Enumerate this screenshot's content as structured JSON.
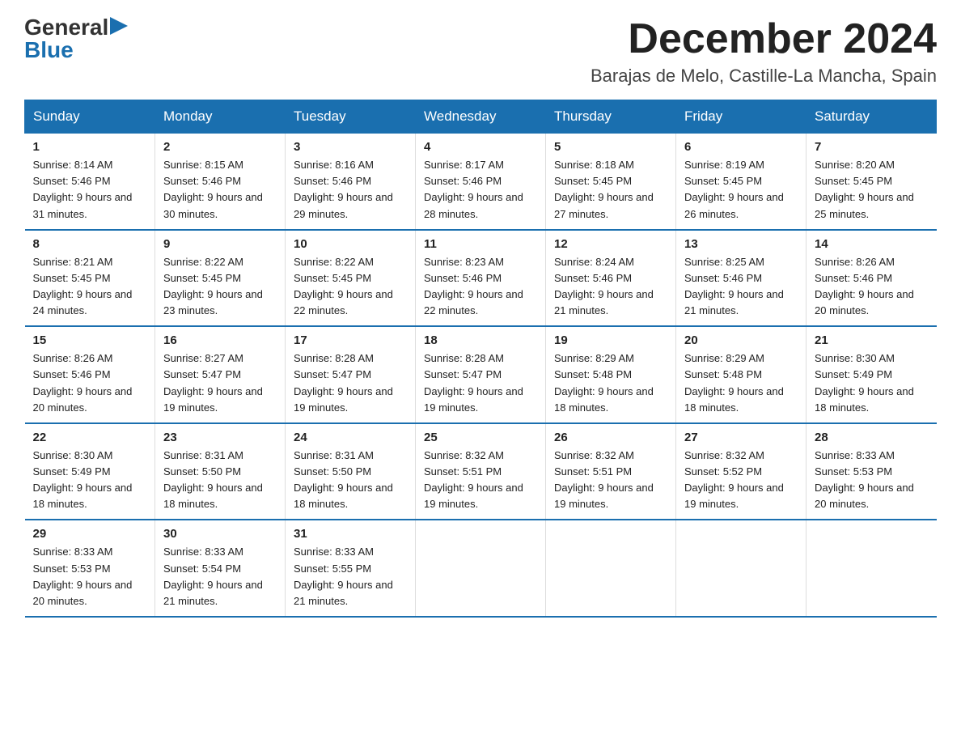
{
  "header": {
    "logo_general": "General",
    "logo_blue": "Blue",
    "month": "December 2024",
    "location": "Barajas de Melo, Castille-La Mancha, Spain"
  },
  "days_of_week": [
    "Sunday",
    "Monday",
    "Tuesday",
    "Wednesday",
    "Thursday",
    "Friday",
    "Saturday"
  ],
  "weeks": [
    [
      {
        "num": "1",
        "sunrise": "8:14 AM",
        "sunset": "5:46 PM",
        "daylight": "9 hours and 31 minutes."
      },
      {
        "num": "2",
        "sunrise": "8:15 AM",
        "sunset": "5:46 PM",
        "daylight": "9 hours and 30 minutes."
      },
      {
        "num": "3",
        "sunrise": "8:16 AM",
        "sunset": "5:46 PM",
        "daylight": "9 hours and 29 minutes."
      },
      {
        "num": "4",
        "sunrise": "8:17 AM",
        "sunset": "5:46 PM",
        "daylight": "9 hours and 28 minutes."
      },
      {
        "num": "5",
        "sunrise": "8:18 AM",
        "sunset": "5:45 PM",
        "daylight": "9 hours and 27 minutes."
      },
      {
        "num": "6",
        "sunrise": "8:19 AM",
        "sunset": "5:45 PM",
        "daylight": "9 hours and 26 minutes."
      },
      {
        "num": "7",
        "sunrise": "8:20 AM",
        "sunset": "5:45 PM",
        "daylight": "9 hours and 25 minutes."
      }
    ],
    [
      {
        "num": "8",
        "sunrise": "8:21 AM",
        "sunset": "5:45 PM",
        "daylight": "9 hours and 24 minutes."
      },
      {
        "num": "9",
        "sunrise": "8:22 AM",
        "sunset": "5:45 PM",
        "daylight": "9 hours and 23 minutes."
      },
      {
        "num": "10",
        "sunrise": "8:22 AM",
        "sunset": "5:45 PM",
        "daylight": "9 hours and 22 minutes."
      },
      {
        "num": "11",
        "sunrise": "8:23 AM",
        "sunset": "5:46 PM",
        "daylight": "9 hours and 22 minutes."
      },
      {
        "num": "12",
        "sunrise": "8:24 AM",
        "sunset": "5:46 PM",
        "daylight": "9 hours and 21 minutes."
      },
      {
        "num": "13",
        "sunrise": "8:25 AM",
        "sunset": "5:46 PM",
        "daylight": "9 hours and 21 minutes."
      },
      {
        "num": "14",
        "sunrise": "8:26 AM",
        "sunset": "5:46 PM",
        "daylight": "9 hours and 20 minutes."
      }
    ],
    [
      {
        "num": "15",
        "sunrise": "8:26 AM",
        "sunset": "5:46 PM",
        "daylight": "9 hours and 20 minutes."
      },
      {
        "num": "16",
        "sunrise": "8:27 AM",
        "sunset": "5:47 PM",
        "daylight": "9 hours and 19 minutes."
      },
      {
        "num": "17",
        "sunrise": "8:28 AM",
        "sunset": "5:47 PM",
        "daylight": "9 hours and 19 minutes."
      },
      {
        "num": "18",
        "sunrise": "8:28 AM",
        "sunset": "5:47 PM",
        "daylight": "9 hours and 19 minutes."
      },
      {
        "num": "19",
        "sunrise": "8:29 AM",
        "sunset": "5:48 PM",
        "daylight": "9 hours and 18 minutes."
      },
      {
        "num": "20",
        "sunrise": "8:29 AM",
        "sunset": "5:48 PM",
        "daylight": "9 hours and 18 minutes."
      },
      {
        "num": "21",
        "sunrise": "8:30 AM",
        "sunset": "5:49 PM",
        "daylight": "9 hours and 18 minutes."
      }
    ],
    [
      {
        "num": "22",
        "sunrise": "8:30 AM",
        "sunset": "5:49 PM",
        "daylight": "9 hours and 18 minutes."
      },
      {
        "num": "23",
        "sunrise": "8:31 AM",
        "sunset": "5:50 PM",
        "daylight": "9 hours and 18 minutes."
      },
      {
        "num": "24",
        "sunrise": "8:31 AM",
        "sunset": "5:50 PM",
        "daylight": "9 hours and 18 minutes."
      },
      {
        "num": "25",
        "sunrise": "8:32 AM",
        "sunset": "5:51 PM",
        "daylight": "9 hours and 19 minutes."
      },
      {
        "num": "26",
        "sunrise": "8:32 AM",
        "sunset": "5:51 PM",
        "daylight": "9 hours and 19 minutes."
      },
      {
        "num": "27",
        "sunrise": "8:32 AM",
        "sunset": "5:52 PM",
        "daylight": "9 hours and 19 minutes."
      },
      {
        "num": "28",
        "sunrise": "8:33 AM",
        "sunset": "5:53 PM",
        "daylight": "9 hours and 20 minutes."
      }
    ],
    [
      {
        "num": "29",
        "sunrise": "8:33 AM",
        "sunset": "5:53 PM",
        "daylight": "9 hours and 20 minutes."
      },
      {
        "num": "30",
        "sunrise": "8:33 AM",
        "sunset": "5:54 PM",
        "daylight": "9 hours and 21 minutes."
      },
      {
        "num": "31",
        "sunrise": "8:33 AM",
        "sunset": "5:55 PM",
        "daylight": "9 hours and 21 minutes."
      },
      null,
      null,
      null,
      null
    ]
  ]
}
